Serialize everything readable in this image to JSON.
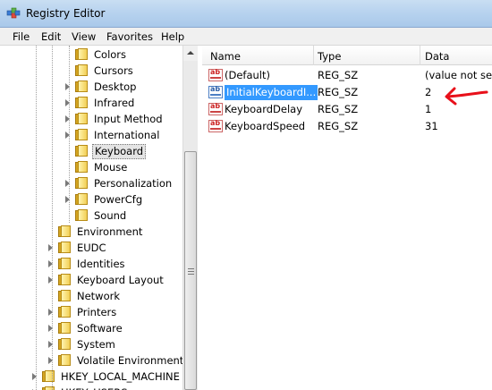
{
  "window": {
    "title": "Registry Editor",
    "icon": "registry-cube-icon"
  },
  "menu": [
    "File",
    "Edit",
    "View",
    "Favorites",
    "Help"
  ],
  "tree": {
    "items": [
      {
        "label": "Colors",
        "level": 3,
        "expandable": false
      },
      {
        "label": "Cursors",
        "level": 3,
        "expandable": false
      },
      {
        "label": "Desktop",
        "level": 3,
        "expandable": true
      },
      {
        "label": "Infrared",
        "level": 3,
        "expandable": true
      },
      {
        "label": "Input Method",
        "level": 3,
        "expandable": true
      },
      {
        "label": "International",
        "level": 3,
        "expandable": true
      },
      {
        "label": "Keyboard",
        "level": 3,
        "expandable": false,
        "selected": true
      },
      {
        "label": "Mouse",
        "level": 3,
        "expandable": false
      },
      {
        "label": "Personalization",
        "level": 3,
        "expandable": true
      },
      {
        "label": "PowerCfg",
        "level": 3,
        "expandable": true
      },
      {
        "label": "Sound",
        "level": 3,
        "expandable": false
      },
      {
        "label": "Environment",
        "level": 2,
        "expandable": false
      },
      {
        "label": "EUDC",
        "level": 2,
        "expandable": true
      },
      {
        "label": "Identities",
        "level": 2,
        "expandable": true
      },
      {
        "label": "Keyboard Layout",
        "level": 2,
        "expandable": true
      },
      {
        "label": "Network",
        "level": 2,
        "expandable": false
      },
      {
        "label": "Printers",
        "level": 2,
        "expandable": true
      },
      {
        "label": "Software",
        "level": 2,
        "expandable": true
      },
      {
        "label": "System",
        "level": 2,
        "expandable": true
      },
      {
        "label": "Volatile Environment",
        "level": 2,
        "expandable": true
      },
      {
        "label": "HKEY_LOCAL_MACHINE",
        "level": 1,
        "expandable": true
      },
      {
        "label": "HKEY_USERS",
        "level": 1,
        "expandable": true
      }
    ]
  },
  "list": {
    "columns": [
      "Name",
      "Type",
      "Data"
    ],
    "rows": [
      {
        "name": "(Default)",
        "type": "REG_SZ",
        "data": "(value not set)"
      },
      {
        "name": "InitialKeyboardI...",
        "type": "REG_SZ",
        "data": "2",
        "selected": true
      },
      {
        "name": "KeyboardDelay",
        "type": "REG_SZ",
        "data": "1"
      },
      {
        "name": "KeyboardSpeed",
        "type": "REG_SZ",
        "data": "31"
      }
    ]
  },
  "annotation": {
    "color": "#e8101a",
    "icon": "red-arrow-pointing-left"
  }
}
